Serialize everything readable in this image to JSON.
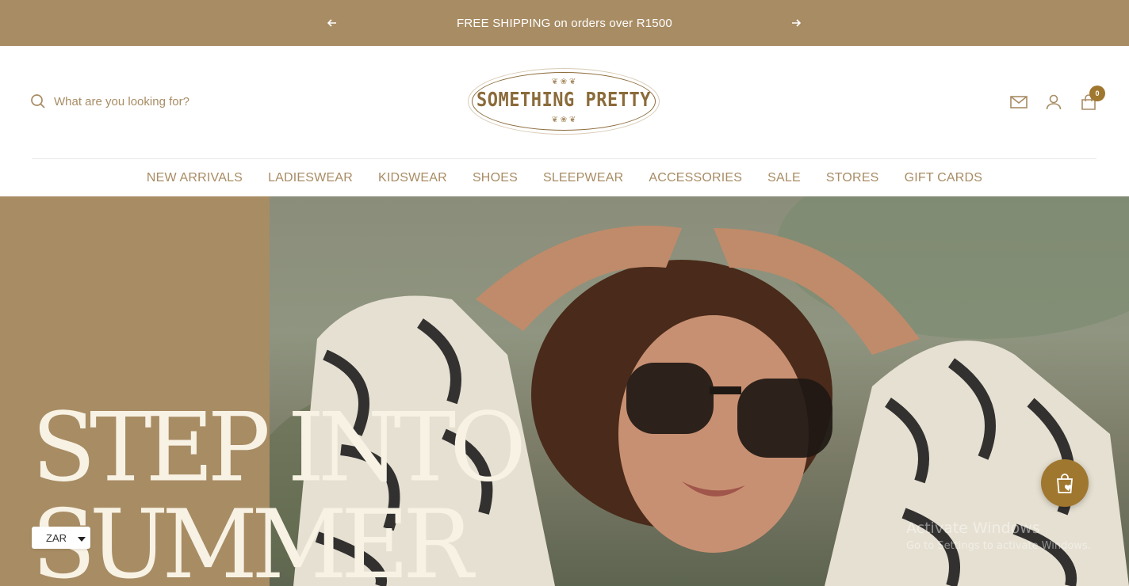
{
  "announcement": {
    "message": "FREE SHIPPING on orders over R1500",
    "prev_icon": "arrow-left-icon",
    "next_icon": "arrow-right-icon"
  },
  "header": {
    "search": {
      "placeholder": "What are you looking for?",
      "value": "",
      "icon": "search-icon"
    },
    "logo": {
      "brand_text": "SOMETHING PRETTY"
    },
    "icons": [
      "newsletter-mail-icon",
      "account-icon",
      "cart-icon"
    ],
    "cart_count": "0"
  },
  "nav": {
    "items": [
      {
        "label": "NEW ARRIVALS"
      },
      {
        "label": "LADIESWEAR"
      },
      {
        "label": "KIDSWEAR"
      },
      {
        "label": "SHOES"
      },
      {
        "label": "SLEEPWEAR"
      },
      {
        "label": "ACCESSORIES"
      },
      {
        "label": "SALE"
      },
      {
        "label": "STORES"
      },
      {
        "label": "GIFT CARDS"
      }
    ]
  },
  "hero": {
    "headline_line1": "STEP INTO",
    "headline_line2": "SUMMER"
  },
  "currency": {
    "selected": "ZAR"
  },
  "floating": {
    "icon": "shopping-bag-heart-icon"
  },
  "watermark": {
    "line1": "Activate Windows",
    "line2": "Go to Settings to activate Windows."
  },
  "colors": {
    "brand_tan": "#a88c64",
    "brand_gold": "#a0772f",
    "logo_brown": "#8b6b3a",
    "headline_cream": "#f7f2e4"
  }
}
